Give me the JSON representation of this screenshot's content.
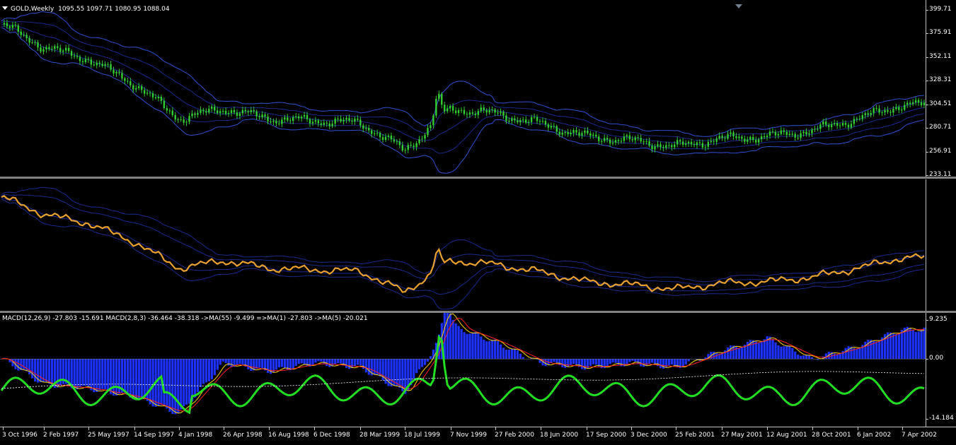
{
  "price_pane": {
    "title": "GOLD,Weekly",
    "ohlc": "1095.55 1097.71 1080.95 1088.04",
    "ticks": [
      "399.71",
      "375.91",
      "352.11",
      "328.31",
      "304.51",
      "280.71",
      "256.91",
      "233.11"
    ]
  },
  "line_pane": {
    "ticks": []
  },
  "macd_pane": {
    "title": "MACD(12,26,9) -27.803 -15.691  MACD(2,8,3) -36.464 -38.318   ->MA(55) -9.499  =>MA(1) -27.803  ->MA(5) -20.021",
    "ticks": [
      "9.235",
      "0.00",
      "-14.184"
    ]
  },
  "x_axis": {
    "labels": [
      "3 Oct 1996",
      "2 Feb 1997",
      "25 May 1997",
      "14 Sep 1997",
      "4 Jan 1998",
      "26 Apr 1998",
      "16 Aug 1998",
      "6 Dec 1998",
      "28 Mar 1999",
      "18 Jul 1999",
      "7 Nov 1999",
      "27 Feb 2000",
      "18 Jun 2000",
      "17 Sep 2000",
      "3 Dec 2000",
      "25 Feb 2001",
      "27 May 2001",
      "12 Aug 2001",
      "28 Oct 2001",
      "6 Jan 2002",
      "7 Apr 2002"
    ]
  },
  "colors": {
    "background": "#000000",
    "candle": "#32cd32",
    "bands": "#3050d0",
    "bands_dark": "#1a2a8a",
    "gold_line": "#e8a030",
    "macd_hist": "#0000dd",
    "macd_hist_fill": "#1e32ff",
    "signal_red": "#ff2020",
    "line_yellow": "#ffd700",
    "green_osc": "#22dd22",
    "dotted": "#ffffff"
  },
  "chart_data": [
    {
      "type": "candlestick",
      "title": "GOLD,Weekly",
      "ylim": [
        233.11,
        399.71
      ],
      "x_labels": [
        "3 Oct 1996",
        "2 Feb 1997",
        "25 May 1997",
        "14 Sep 1997",
        "4 Jan 1998",
        "26 Apr 1998",
        "16 Aug 1998",
        "6 Dec 1998",
        "28 Mar 1999",
        "18 Jul 1999",
        "7 Nov 1999",
        "27 Feb 2000",
        "18 Jun 2000",
        "17 Sep 2000",
        "3 Dec 2000",
        "25 Feb 2001",
        "27 May 2001",
        "12 Aug 2001",
        "28 Oct 2001",
        "6 Jan 2002",
        "7 Apr 2002"
      ],
      "close_at_labels": [
        385,
        362,
        350,
        325,
        290,
        300,
        290,
        288,
        286,
        258,
        300,
        295,
        285,
        272,
        268,
        262,
        270,
        272,
        278,
        290,
        304
      ]
    },
    {
      "type": "line",
      "close_at_labels": [
        385,
        362,
        350,
        325,
        290,
        300,
        290,
        288,
        286,
        258,
        300,
        295,
        285,
        272,
        268,
        262,
        270,
        272,
        278,
        290,
        304
      ]
    },
    {
      "type": "histogram+lines",
      "ylim": [
        -14.184,
        9.235
      ],
      "x_labels": [
        "3 Oct 1996",
        "2 Feb 1997",
        "25 May 1997",
        "14 Sep 1997",
        "4 Jan 1998",
        "26 Apr 1998",
        "16 Aug 1998",
        "6 Dec 1998",
        "28 Mar 1999",
        "18 Jul 1999",
        "7 Nov 1999",
        "27 Feb 2000",
        "18 Jun 2000",
        "17 Sep 2000",
        "3 Dec 2000",
        "25 Feb 2001",
        "27 May 2001",
        "12 Aug 2001",
        "28 Oct 2001",
        "6 Jan 2002",
        "7 Apr 2002"
      ],
      "macd_at_labels": [
        0,
        -6,
        -7,
        -9,
        -13,
        -1,
        -3,
        -1,
        -2,
        -8,
        8,
        4,
        -1,
        -2,
        -1,
        -2,
        2,
        5,
        0,
        3,
        7
      ]
    }
  ]
}
